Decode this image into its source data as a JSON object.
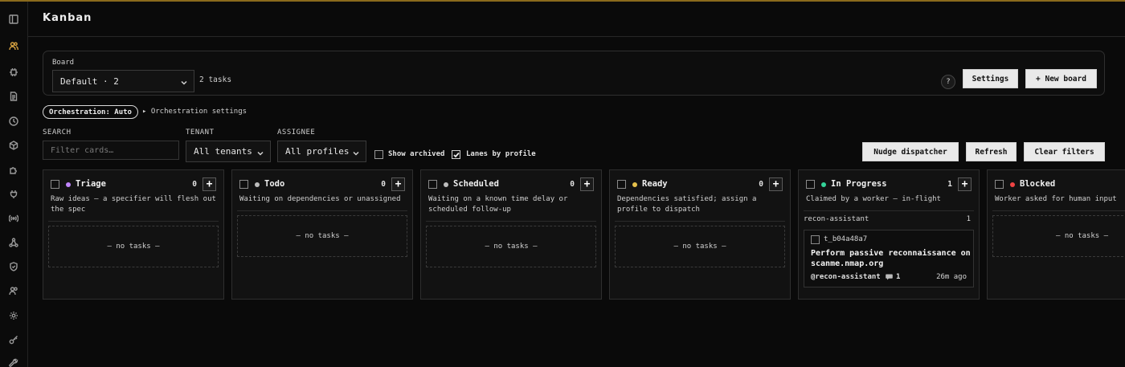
{
  "page": {
    "title": "Kanban"
  },
  "board": {
    "label": "Board",
    "selected": "Default · 2",
    "task_count": "2 tasks"
  },
  "actions": {
    "help": "?",
    "settings": "Settings",
    "new_board": "+ New board"
  },
  "orchestration": {
    "pill": "Orchestration: Auto",
    "link": "▸ Orchestration settings"
  },
  "filters": {
    "search_label": "SEARCH",
    "search_placeholder": "Filter cards…",
    "tenant_label": "TENANT",
    "tenant_value": "All tenants",
    "assignee_label": "ASSIGNEE",
    "assignee_value": "All profiles",
    "show_archived": {
      "label": "Show archived",
      "checked": false
    },
    "lanes_by_profile": {
      "label": "Lanes by profile",
      "checked": true
    }
  },
  "toolbar": {
    "nudge": "Nudge dispatcher",
    "refresh": "Refresh",
    "clear": "Clear filters"
  },
  "columns": [
    {
      "key": "triage",
      "title": "Triage",
      "count": "0",
      "color": "#c084fc",
      "description": "Raw ideas — a specifier will flesh out the spec",
      "empty": "— no tasks —"
    },
    {
      "key": "todo",
      "title": "Todo",
      "count": "0",
      "color": "#bdbdbd",
      "description": "Waiting on dependencies or unassigned",
      "empty": "— no tasks —"
    },
    {
      "key": "scheduled",
      "title": "Scheduled",
      "count": "0",
      "color": "#bdbdbd",
      "description": "Waiting on a known time delay or scheduled follow-up",
      "empty": "— no tasks —"
    },
    {
      "key": "ready",
      "title": "Ready",
      "count": "0",
      "color": "#e5c04b",
      "description": "Dependencies satisfied; assign a profile to dispatch",
      "empty": "— no tasks —"
    },
    {
      "key": "in-progress",
      "title": "In Progress",
      "count": "1",
      "color": "#34d399",
      "description": "Claimed by a worker — in-flight",
      "lane": {
        "name": "recon-assistant",
        "count": "1"
      },
      "card": {
        "id": "t_b04a48a7",
        "title": "Perform passive reconnaissance on scanme.nmap.org",
        "assignee": "@recon-assistant",
        "comments": "1",
        "time": "26m ago"
      }
    },
    {
      "key": "blocked",
      "title": "Blocked",
      "count": "",
      "color": "#ef4444",
      "description": "Worker asked for human input",
      "empty": "— no tasks —"
    }
  ],
  "sidebar": {
    "icons": [
      "panel-icon",
      "users-icon",
      "chip-icon",
      "document-icon",
      "clock-icon",
      "cube-icon",
      "puzzle-icon",
      "plug-icon",
      "broadcast-icon",
      "network-icon",
      "shield-icon",
      "people-icon",
      "gear-icon",
      "key-icon",
      "wrench-icon"
    ],
    "active_index": 1,
    "accent": "#d9a441"
  }
}
